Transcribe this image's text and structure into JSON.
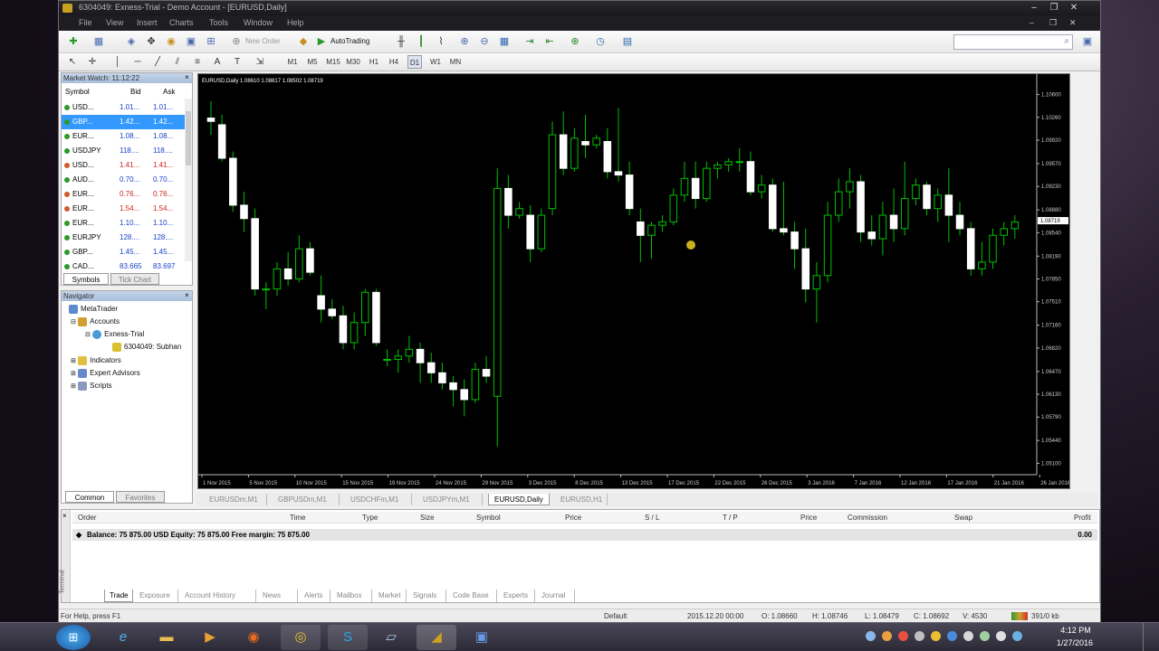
{
  "window": {
    "title": "6304049: Exness-Trial - Demo Account - [EURUSD,Daily]",
    "controls": [
      "–",
      "❐",
      "✕"
    ]
  },
  "menu": [
    "File",
    "View",
    "Insert",
    "Charts",
    "Tools",
    "Window",
    "Help"
  ],
  "toolbar": {
    "new_order": "New Order",
    "autotrading": "AutoTrading",
    "timeframes": [
      "M1",
      "M5",
      "M15",
      "M30",
      "H1",
      "H4",
      "D1",
      "W1",
      "MN"
    ],
    "active_timeframe": "D1"
  },
  "market_watch": {
    "title": "Market Watch: 11:12:22",
    "columns": {
      "symbol": "Symbol",
      "bid": "Bid",
      "ask": "Ask"
    },
    "rows": [
      {
        "symbol": "USD...",
        "bid": "1.01...",
        "ask": "1.01...",
        "dir": "up",
        "selected": false
      },
      {
        "symbol": "GBP...",
        "bid": "1.42...",
        "ask": "1.42...",
        "dir": "up",
        "selected": true
      },
      {
        "symbol": "EUR...",
        "bid": "1.08...",
        "ask": "1.08...",
        "dir": "up",
        "selected": false
      },
      {
        "symbol": "USDJPY",
        "bid": "118....",
        "ask": "118....",
        "dir": "up",
        "selected": false
      },
      {
        "symbol": "USD...",
        "bid": "1.41...",
        "ask": "1.41...",
        "dir": "down",
        "selected": false
      },
      {
        "symbol": "AUD...",
        "bid": "0.70...",
        "ask": "0.70...",
        "dir": "up",
        "selected": false
      },
      {
        "symbol": "EUR...",
        "bid": "0.76...",
        "ask": "0.76...",
        "dir": "down",
        "selected": false
      },
      {
        "symbol": "EUR...",
        "bid": "1.54...",
        "ask": "1.54...",
        "dir": "down",
        "selected": false
      },
      {
        "symbol": "EUR...",
        "bid": "1.10...",
        "ask": "1.10...",
        "dir": "up",
        "selected": false
      },
      {
        "symbol": "EURJPY",
        "bid": "128....",
        "ask": "128....",
        "dir": "up",
        "selected": false
      },
      {
        "symbol": "GBP...",
        "bid": "1.45...",
        "ask": "1.45...",
        "dir": "up",
        "selected": false
      },
      {
        "symbol": "CAD...",
        "bid": "83.665",
        "ask": "83.697",
        "dir": "up",
        "selected": false
      }
    ],
    "tabs": [
      "Symbols",
      "Tick Chart"
    ]
  },
  "navigator": {
    "title": "Navigator",
    "items": [
      "MetaTrader",
      "Accounts",
      "Exness-Trial",
      "6304049: Subhan",
      "Indicators",
      "Expert Advisors",
      "Scripts"
    ],
    "tabs": [
      "Common",
      "Favorites"
    ]
  },
  "chart_data": {
    "type": "candlestick",
    "title": "EURUSD,Daily",
    "ohlc_header": "1.08610 1.08817 1.08502 1.08719",
    "y_ticks": [
      "1.10600",
      "1.10260",
      "1.09920",
      "1.09570",
      "1.09230",
      "1.08880",
      "1.08540",
      "1.08190",
      "1.07850",
      "1.07510",
      "1.07160",
      "1.06820",
      "1.06470",
      "1.06130",
      "1.05790",
      "1.05440",
      "1.05100"
    ],
    "ylim": [
      1.0493,
      1.1077
    ],
    "current_price": "1.08719",
    "x_ticks": [
      "1 Nov 2015",
      "5 Nov 2015",
      "10 Nov 2015",
      "15 Nov 2015",
      "19 Nov 2015",
      "24 Nov 2015",
      "29 Nov 2015",
      "3 Dec 2015",
      "8 Dec 2015",
      "13 Dec 2015",
      "17 Dec 2015",
      "22 Dec 2015",
      "26 Dec 2015",
      "3 Jan 2016",
      "7 Jan 2016",
      "12 Jan 2016",
      "17 Jan 2016",
      "21 Jan 2016",
      "26 Jan 2016"
    ],
    "candles": [
      [
        1.1025,
        1.105,
        1.1,
        1.102
      ],
      [
        1.1015,
        1.103,
        1.096,
        1.0965
      ],
      [
        1.0965,
        1.0975,
        1.0885,
        1.0895
      ],
      [
        1.0895,
        1.0915,
        1.0855,
        1.0875
      ],
      [
        1.0875,
        1.089,
        1.076,
        1.077
      ],
      [
        1.077,
        1.078,
        1.074,
        1.077
      ],
      [
        1.077,
        1.081,
        1.076,
        1.08
      ],
      [
        1.08,
        1.0825,
        1.0775,
        1.0785
      ],
      [
        1.0785,
        1.085,
        1.078,
        1.083
      ],
      [
        1.083,
        1.084,
        1.079,
        1.0795
      ],
      [
        1.076,
        1.079,
        1.072,
        1.074
      ],
      [
        1.074,
        1.0755,
        1.0725,
        1.073
      ],
      [
        1.073,
        1.0745,
        1.068,
        1.069
      ],
      [
        1.069,
        1.0735,
        1.068,
        1.072
      ],
      [
        1.072,
        1.077,
        1.07,
        1.0765
      ],
      [
        1.0765,
        1.077,
        1.0685,
        1.069
      ],
      [
        1.0665,
        1.068,
        1.0655,
        1.0665
      ],
      [
        1.0665,
        1.068,
        1.0645,
        1.067
      ],
      [
        1.067,
        1.07,
        1.066,
        1.068
      ],
      [
        1.068,
        1.069,
        1.063,
        1.066
      ],
      [
        1.066,
        1.0675,
        1.063,
        1.0645
      ],
      [
        1.0645,
        1.066,
        1.062,
        1.063
      ],
      [
        1.063,
        1.064,
        1.0595,
        1.062
      ],
      [
        1.062,
        1.0635,
        1.058,
        1.0605
      ],
      [
        1.0605,
        1.066,
        1.06,
        1.065
      ],
      [
        1.065,
        1.067,
        1.063,
        1.064
      ],
      [
        1.061,
        1.095,
        1.0535,
        1.092
      ],
      [
        1.092,
        1.094,
        1.086,
        1.088
      ],
      [
        1.088,
        1.09,
        1.0875,
        1.089
      ],
      [
        1.088,
        1.0895,
        1.081,
        1.083
      ],
      [
        1.083,
        1.089,
        1.0825,
        1.088
      ],
      [
        1.089,
        1.102,
        1.088,
        1.1
      ],
      [
        1.1,
        1.1035,
        1.094,
        1.095
      ],
      [
        1.095,
        1.101,
        1.0945,
        1.0995
      ],
      [
        1.099,
        1.103,
        1.0965,
        1.0985
      ],
      [
        1.0985,
        1.1,
        1.098,
        1.0995
      ],
      [
        1.099,
        1.101,
        1.0935,
        1.0945
      ],
      [
        1.0945,
        1.104,
        1.093,
        1.094
      ],
      [
        1.094,
        1.096,
        1.088,
        1.089
      ],
      [
        1.087,
        1.089,
        1.081,
        1.085
      ],
      [
        1.085,
        1.087,
        1.0815,
        1.0865
      ],
      [
        1.0865,
        1.088,
        1.0855,
        1.087
      ],
      [
        1.087,
        1.092,
        1.0865,
        1.091
      ],
      [
        1.091,
        1.096,
        1.09,
        1.0935
      ],
      [
        1.0935,
        1.096,
        1.089,
        1.0905
      ],
      [
        1.0905,
        1.096,
        1.09,
        1.095
      ],
      [
        1.095,
        1.096,
        1.0935,
        1.0955
      ],
      [
        1.0955,
        1.0965,
        1.0945,
        1.096
      ],
      [
        1.096,
        1.098,
        1.0945,
        1.096
      ],
      [
        1.096,
        1.0975,
        1.091,
        1.0915
      ],
      [
        1.0915,
        1.094,
        1.0905,
        1.0925
      ],
      [
        1.0925,
        1.0935,
        1.0855,
        1.086
      ],
      [
        1.086,
        1.093,
        1.085,
        1.0855
      ],
      [
        1.0855,
        1.087,
        1.08,
        1.083
      ],
      [
        1.083,
        1.086,
        1.075,
        1.077
      ],
      [
        1.077,
        1.081,
        1.072,
        1.079
      ],
      [
        1.079,
        1.09,
        1.078,
        1.088
      ],
      [
        1.088,
        1.0935,
        1.087,
        1.0915
      ],
      [
        1.0915,
        1.095,
        1.089,
        1.093
      ],
      [
        1.093,
        1.094,
        1.084,
        1.0855
      ],
      [
        1.0855,
        1.088,
        1.0835,
        1.0845
      ],
      [
        1.0845,
        1.09,
        1.082,
        1.088
      ],
      [
        1.088,
        1.092,
        1.084,
        1.086
      ],
      [
        1.086,
        1.096,
        1.085,
        1.0905
      ],
      [
        1.0905,
        1.0935,
        1.0895,
        1.0925
      ],
      [
        1.0925,
        1.093,
        1.088,
        1.089
      ],
      [
        1.089,
        1.092,
        1.087,
        1.091
      ],
      [
        1.091,
        1.095,
        1.084,
        1.088
      ],
      [
        1.088,
        1.09,
        1.085,
        1.086
      ],
      [
        1.086,
        1.087,
        1.079,
        1.08
      ],
      [
        1.08,
        1.084,
        1.079,
        1.081
      ],
      [
        1.081,
        1.086,
        1.08,
        1.085
      ],
      [
        1.085,
        1.087,
        1.0835,
        1.086
      ],
      [
        1.086,
        1.088,
        1.0845,
        1.087
      ]
    ]
  },
  "chart_tabs": [
    "EURUSDm,M1",
    "GBPUSDm,M1",
    "USDCHFm,M1",
    "USDJPYm,M1",
    "EURUSD,Daily",
    "EURUSD,H1"
  ],
  "active_chart_tab": "EURUSD,Daily",
  "terminal": {
    "columns": [
      "Order",
      "Time",
      "Type",
      "Size",
      "Symbol",
      "Price",
      "S / L",
      "T / P",
      "Price",
      "Commission",
      "Swap",
      "Profit"
    ],
    "balance_line": "Balance: 75 875.00 USD  Equity: 75 875.00  Free margin: 75 875.00",
    "balance_profit": "0.00",
    "side_label": "Terminal",
    "tabs": [
      "Trade",
      "Exposure",
      "Account History",
      "News",
      "Alerts",
      "Mailbox",
      "Market",
      "Signals",
      "Code Base",
      "Experts",
      "Journal"
    ]
  },
  "status": {
    "help": "For Help, press F1",
    "profile": "Default",
    "datetime": "2015.12.20 00:00",
    "open": "O: 1.08660",
    "high": "H: 1.08746",
    "low": "L: 1.08479",
    "close": "C: 1.08692",
    "volume": "V: 4530",
    "traffic": "391/0 kb"
  },
  "taskbar": {
    "clock_time": "4:12 PM",
    "clock_date": "1/27/2016"
  },
  "colors": {
    "bull": "#000000",
    "bear": "#ffffff",
    "wick": "#00c000",
    "chart_bg": "#000000"
  }
}
